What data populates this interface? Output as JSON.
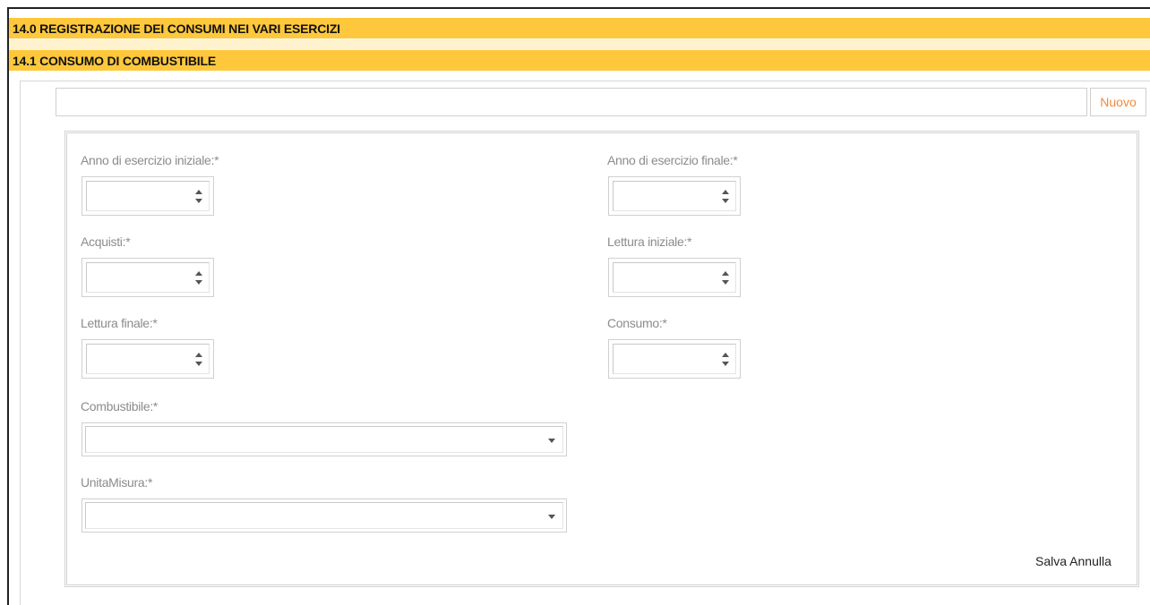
{
  "sections": {
    "main_title": "14.0 REGISTRAZIONE DEI CONSUMI NEI VARI ESERCIZI",
    "sub_title": "14.1 CONSUMO DI COMBUSTIBILE"
  },
  "toolbar": {
    "new_label": "Nuovo",
    "new_color": "#f08a3c"
  },
  "form": {
    "anno_iniziale_label": "Anno di esercizio iniziale:*",
    "anno_finale_label": "Anno di esercizio finale:*",
    "acquisti_label": "Acquisti:*",
    "lettura_iniziale_label": "Lettura iniziale:*",
    "lettura_finale_label": "Lettura finale:*",
    "consumo_label": "Consumo:*",
    "combustibile_label": "Combustibile:*",
    "unita_misura_label": "UnitaMisura:*",
    "save_label": "Salva",
    "cancel_label": "Annulla"
  },
  "colors": {
    "header_bg": "#ffc83c",
    "label_text": "#8c8c8c"
  }
}
